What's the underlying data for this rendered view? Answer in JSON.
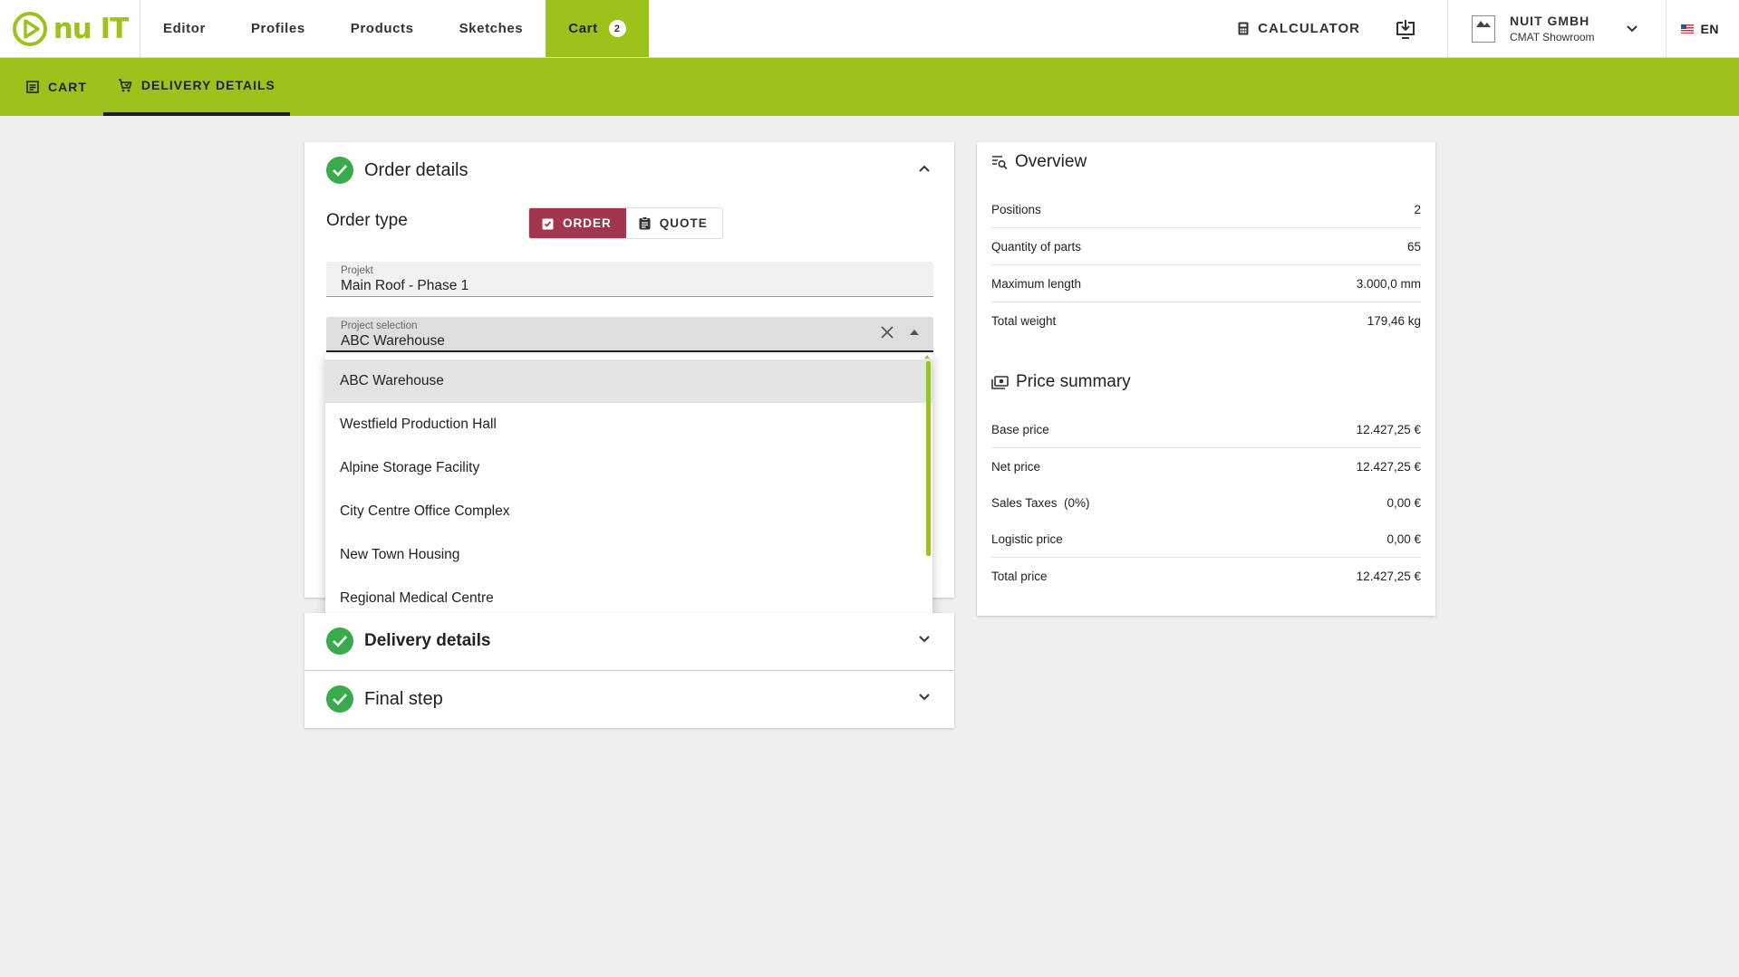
{
  "app": {
    "logo_text": "nu IT",
    "brand_color": "#9dc31a",
    "accent_color": "#a3354f",
    "success_color": "#3aaa4f"
  },
  "topnav": {
    "items": [
      {
        "label": "Editor"
      },
      {
        "label": "Profiles"
      },
      {
        "label": "Products"
      },
      {
        "label": "Sketches"
      }
    ],
    "cart": {
      "label": "Cart",
      "count": "2"
    },
    "calculator_label": "CALCULATOR",
    "company_name": "NUIT GMBH",
    "company_sub": "CMAT Showroom",
    "language": "EN"
  },
  "subnav": {
    "tabs": [
      {
        "label": "CART",
        "icon": "list-icon"
      },
      {
        "label": "DELIVERY DETAILS",
        "icon": "cart-icon"
      }
    ]
  },
  "order_details": {
    "title": "Order details",
    "order_type_label": "Order type",
    "order_button": "ORDER",
    "quote_button": "QUOTE",
    "project_field": {
      "label": "Projekt",
      "value": "Main Roof - Phase 1"
    },
    "project_selection": {
      "label": "Project selection",
      "value": "ABC Warehouse"
    },
    "options": [
      "ABC Warehouse",
      "Westfield Production Hall",
      "Alpine Storage Facility",
      "City Centre Office Complex",
      "New Town Housing",
      "Regional Medical Centre"
    ]
  },
  "delivery_details": {
    "title": "Delivery details"
  },
  "final_step": {
    "title": "Final step"
  },
  "overview": {
    "title": "Overview",
    "rows": [
      {
        "label": "Positions",
        "value": "2"
      },
      {
        "label": "Quantity of parts",
        "value": "65"
      },
      {
        "label": "Maximum length",
        "value": "3.000,0 mm"
      },
      {
        "label": "Total weight",
        "value": "179,46 kg"
      }
    ]
  },
  "price_summary": {
    "title": "Price summary",
    "rows": [
      {
        "label": "Base price",
        "value": "12.427,25 €"
      },
      {
        "label": "Net price",
        "value": "12.427,25 €"
      },
      {
        "label": "Sales Taxes  (0%)",
        "value": "0,00 €"
      },
      {
        "label": "Logistic price",
        "value": "0,00 €"
      },
      {
        "label": "Total price",
        "value": "12.427,25 €"
      }
    ]
  }
}
